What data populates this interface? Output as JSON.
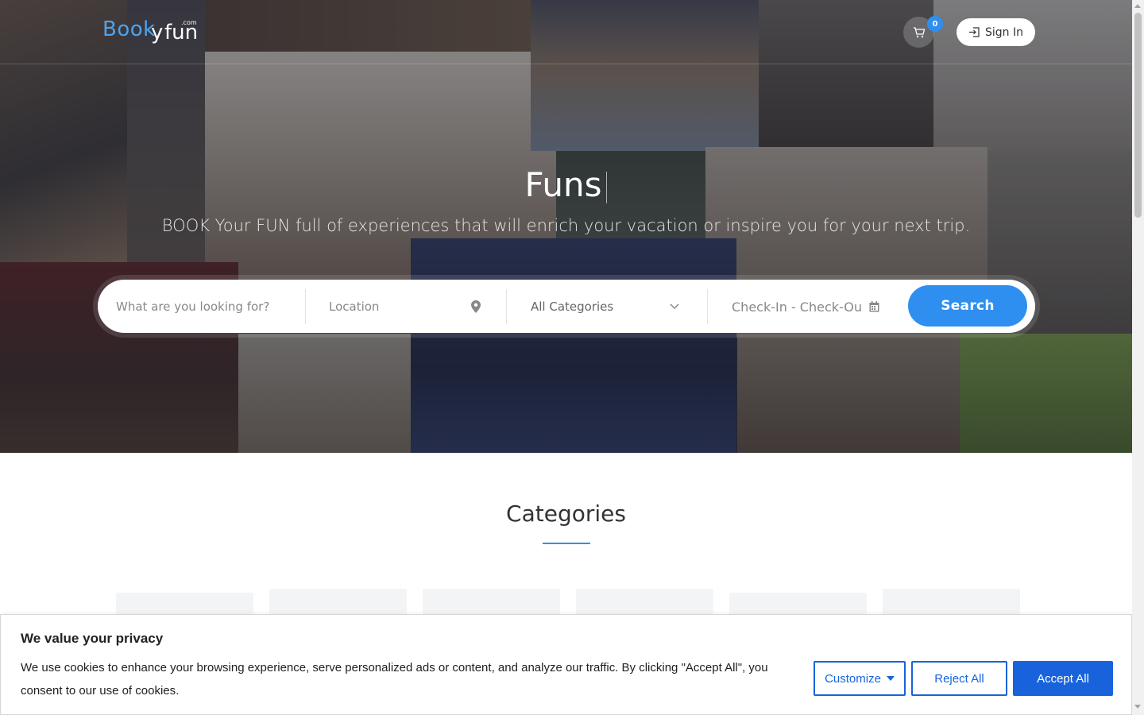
{
  "header": {
    "logo": {
      "part1": "Book",
      "part2": "y",
      "part3": "fun",
      "suffix": ".com"
    },
    "cart_count": "0",
    "signin_label": "Sign In"
  },
  "hero": {
    "title": "Funs",
    "subtitle": "BOOK Your FUN full of experiences that will enrich your vacation or inspire you for your next trip."
  },
  "search": {
    "keyword_placeholder": "What are you looking for?",
    "location_placeholder": "Location",
    "category_selected": "All Categories",
    "dates_placeholder": "Check-In - Check-Out",
    "button_label": "Search"
  },
  "categories": {
    "heading": "Categories"
  },
  "cookie": {
    "title": "We value your privacy",
    "text": "We use cookies to enhance your browsing experience, serve personalized ads or content, and analyze our traffic. By clicking \"Accept All\", you consent to our use of cookies.",
    "customize_label": "Customize",
    "reject_label": "Reject All",
    "accept_label": "Accept All"
  },
  "colors": {
    "accent": "#2e8ff0",
    "cookie_accent": "#1863dc"
  },
  "icons": {
    "cart": "cart-icon",
    "signin": "login-icon",
    "location": "map-pin-icon",
    "dropdown": "chevron-down-icon",
    "calendar": "calendar-icon"
  }
}
